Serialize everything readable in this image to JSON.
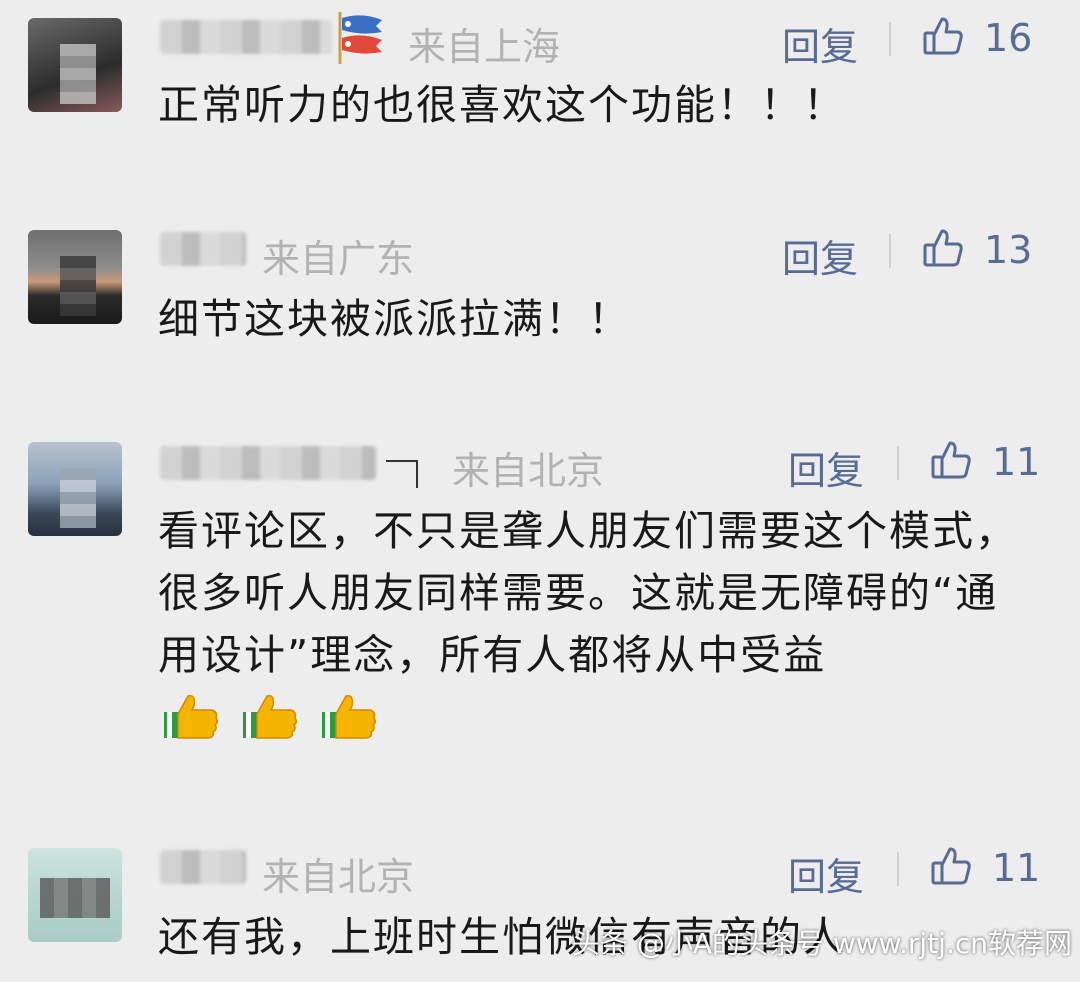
{
  "comments": [
    {
      "location": "来自上海",
      "reply_label": "回复",
      "likes": "16",
      "content": "正常听力的也很喜欢这个功能！！！"
    },
    {
      "location": "来自广东",
      "reply_label": "回复",
      "likes": "13",
      "content": "细节这块被派派拉满！！"
    },
    {
      "location": "来自北京",
      "reply_label": "回复",
      "likes": "11",
      "content": "看评论区，不只是聋人朋友们需要这个模式，很多听人朋友同样需要。这就是无障碍的“通用设计”理念，所有人都将从中受益"
    },
    {
      "location": "来自北京",
      "reply_label": "回复",
      "likes": "11",
      "content": "还有我，上班时生怕微信有声音的人"
    }
  ],
  "watermark": "头条 @小A的头条号 www.rjtj.cn软荐网",
  "colors": {
    "link": "#576b95",
    "meta": "#b2b2b2",
    "text": "#191919",
    "background": "#ededed"
  },
  "icons": {
    "like": "thumbs-up-outline-icon",
    "emoji": "thumbs-up-emoji"
  }
}
